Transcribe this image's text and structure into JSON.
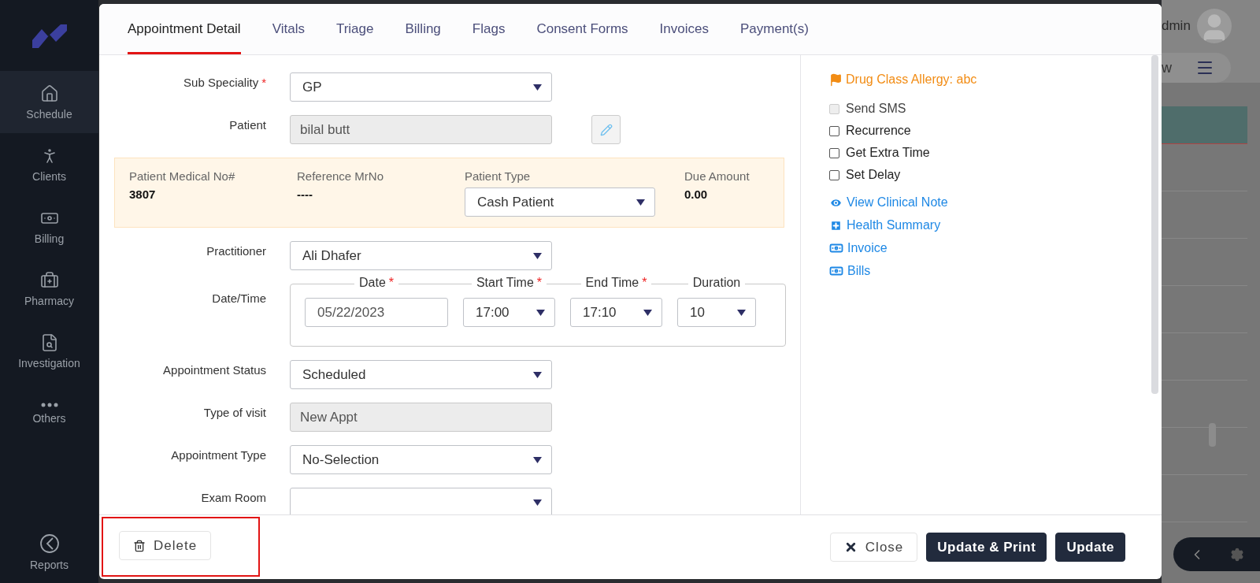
{
  "sidebar": {
    "items": [
      {
        "label": "Schedule",
        "selected": true
      },
      {
        "label": "Clients",
        "selected": false
      },
      {
        "label": "Billing",
        "selected": false
      },
      {
        "label": "Pharmacy",
        "selected": false
      },
      {
        "label": "Investigation",
        "selected": false
      },
      {
        "label": "Others",
        "selected": false
      }
    ],
    "footer_item": {
      "label": "Reports",
      "selected": false
    }
  },
  "background": {
    "user": "dmin",
    "view_button": "w"
  },
  "modal": {
    "tabs": [
      {
        "label": "Appointment Detail",
        "selected": true
      },
      {
        "label": "Vitals",
        "selected": false
      },
      {
        "label": "Triage",
        "selected": false
      },
      {
        "label": "Billing",
        "selected": false
      },
      {
        "label": "Flags",
        "selected": false
      },
      {
        "label": "Consent Forms",
        "selected": false
      },
      {
        "label": "Invoices",
        "selected": false
      },
      {
        "label": "Payment(s)",
        "selected": false
      }
    ],
    "form": [
      {
        "kind": "select",
        "label": "Sub Speciality",
        "marker": "*",
        "value": "GP"
      },
      {
        "kind": "readonly",
        "label": "Patient",
        "value": "bilal butt",
        "edit_button": true
      },
      {
        "kind": "info",
        "items": [
          {
            "kind": "text",
            "label": "Patient Medical No#",
            "value": "3807"
          },
          {
            "kind": "text",
            "label": "Reference MrNo",
            "value": "----"
          },
          {
            "kind": "select",
            "label": "Patient Type",
            "value": "Cash Patient"
          },
          {
            "kind": "text",
            "label": "Due Amount",
            "value": "0.00"
          }
        ]
      },
      {
        "kind": "select",
        "label": "Practitioner",
        "value": "Ali Dhafer"
      },
      {
        "kind": "datetime",
        "label": "Date/Time",
        "parts": [
          {
            "kind": "text",
            "label": "Date",
            "marker": "*",
            "value": "05/22/2023"
          },
          {
            "kind": "select",
            "label": "Start Time",
            "marker": "*",
            "value": "17:00"
          },
          {
            "kind": "select",
            "label": "End Time",
            "marker": "*",
            "value": "17:10"
          },
          {
            "kind": "select",
            "label": "Duration",
            "value": "10"
          }
        ]
      },
      {
        "kind": "select",
        "label": "Appointment Status",
        "value": "Scheduled"
      },
      {
        "kind": "readonly",
        "label": "Type of visit",
        "value": "New Appt"
      },
      {
        "kind": "select",
        "label": "Appointment Type",
        "value": "No-Selection"
      },
      {
        "kind": "select",
        "label": "Exam Room"
      }
    ],
    "side": {
      "allergy": "Drug Class Allergy: abc",
      "checkboxes": [
        {
          "label": "Send SMS",
          "checked": false,
          "disabled": true
        },
        {
          "label": "Recurrence",
          "checked": false,
          "disabled": false
        },
        {
          "label": "Get Extra Time",
          "checked": false,
          "disabled": false
        },
        {
          "label": "Set Delay",
          "checked": false,
          "disabled": false
        }
      ],
      "links": [
        {
          "label": "View Clinical Note",
          "kind": "eye"
        },
        {
          "label": "Health Summary",
          "kind": "plus"
        },
        {
          "label": "Invoice",
          "kind": "money"
        },
        {
          "label": "Bills",
          "kind": "money"
        }
      ]
    },
    "footer": {
      "delete": {
        "label": "Delete",
        "highlighted": true
      },
      "buttons": [
        {
          "label": "Close",
          "kind": "outline"
        },
        {
          "label": "Update & Print",
          "kind": "primary"
        },
        {
          "label": "Update",
          "kind": "primary"
        }
      ]
    }
  }
}
